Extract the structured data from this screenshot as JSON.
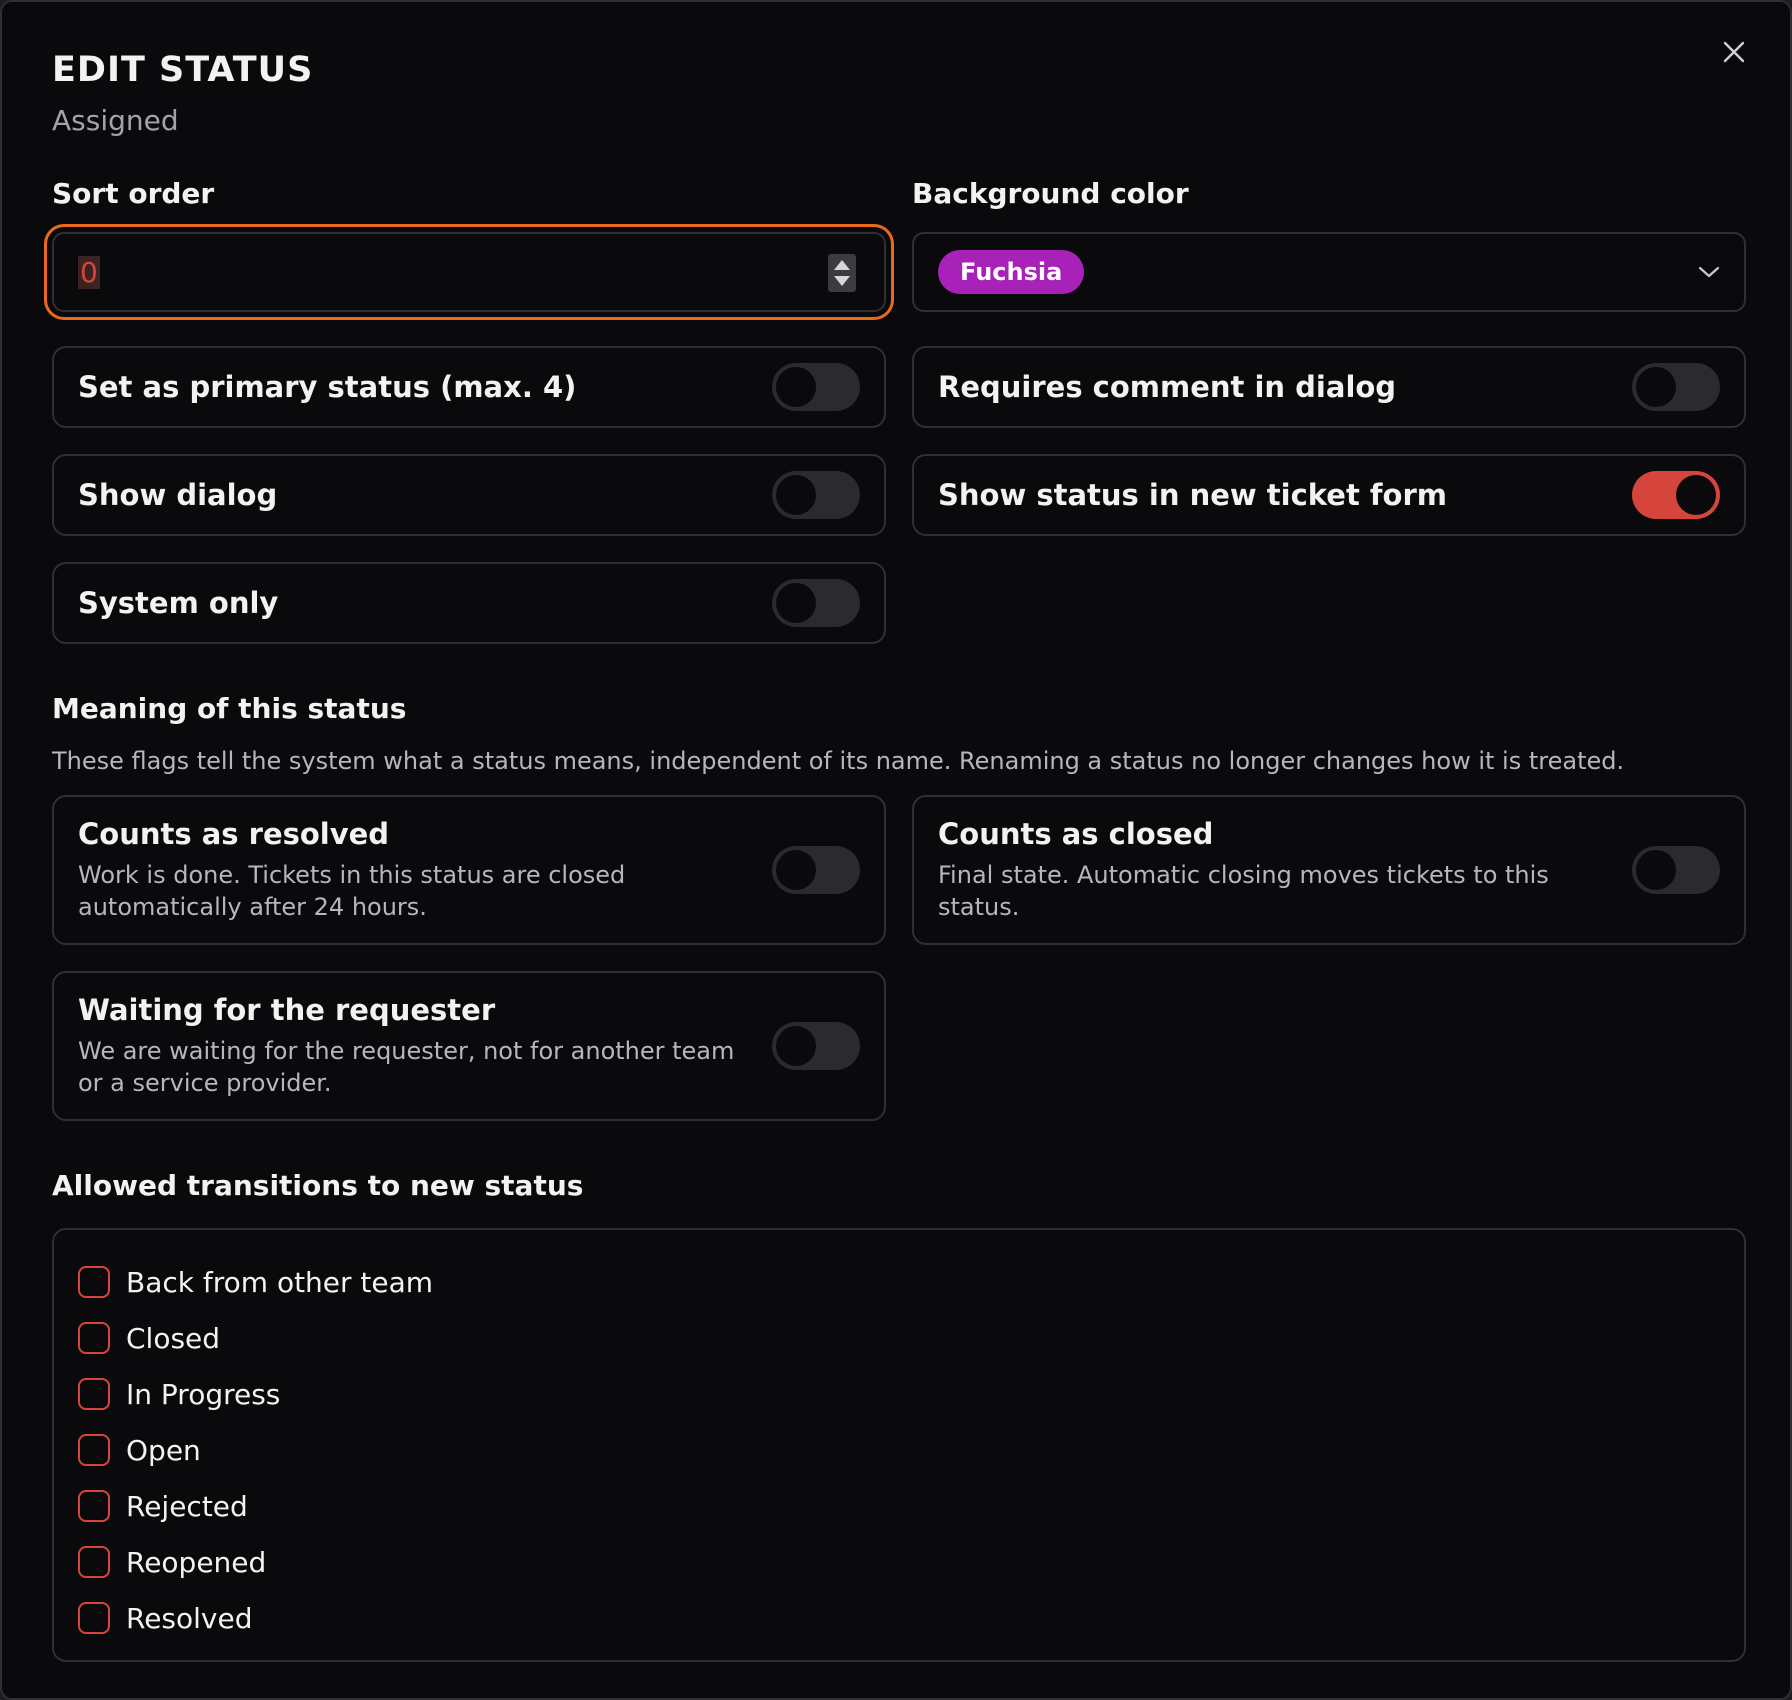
{
  "dialog": {
    "title": "EDIT STATUS",
    "subtitle": "Assigned",
    "close_icon": "close-icon"
  },
  "sort_order": {
    "label": "Sort order",
    "value": "0"
  },
  "background_color": {
    "label": "Background color",
    "selected": "Fuchsia",
    "badge_color": "#a821b8"
  },
  "toggles": [
    {
      "label": "Set as primary status (max. 4)",
      "on": false
    },
    {
      "label": "Requires comment in dialog",
      "on": false
    },
    {
      "label": "Show dialog",
      "on": false
    },
    {
      "label": "Show status in new ticket form",
      "on": true
    },
    {
      "label": "System only",
      "on": false
    }
  ],
  "meaning": {
    "title": "Meaning of this status",
    "description": "These flags tell the system what a status means, independent of its name. Renaming a status no longer changes how it is treated.",
    "flags": [
      {
        "title": "Counts as resolved",
        "description": "Work is done. Tickets in this status are closed automatically after 24 hours.",
        "on": false
      },
      {
        "title": "Counts as closed",
        "description": "Final state. Automatic closing moves tickets to this status.",
        "on": false
      },
      {
        "title": "Waiting for the requester",
        "description": "We are waiting for the requester, not for another team or a service provider.",
        "on": false
      }
    ]
  },
  "transitions": {
    "title": "Allowed transitions to new status",
    "items": [
      {
        "label": "Back from other team",
        "checked": false
      },
      {
        "label": "Closed",
        "checked": false
      },
      {
        "label": "In Progress",
        "checked": false
      },
      {
        "label": "Open",
        "checked": false
      },
      {
        "label": "Rejected",
        "checked": false
      },
      {
        "label": "Reopened",
        "checked": false
      },
      {
        "label": "Resolved",
        "checked": false
      }
    ]
  },
  "colors": {
    "accent": "#d6453c",
    "focus_ring": "#ea6a1c",
    "background": "#0a0a0c"
  }
}
